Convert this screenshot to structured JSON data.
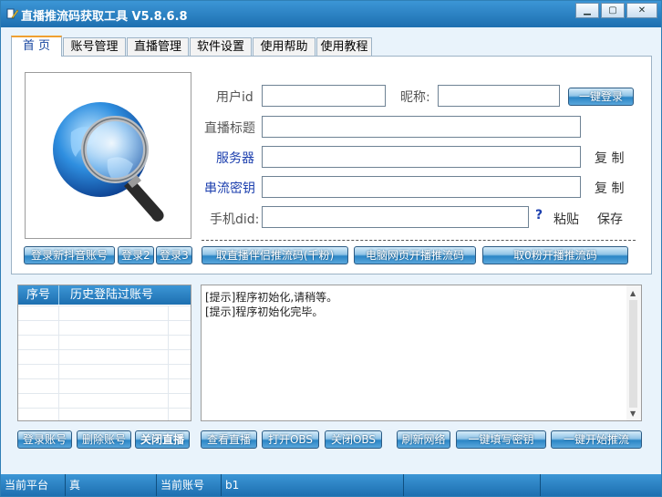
{
  "window": {
    "title": "直播推流码获取工具 V5.8.6.8",
    "controls": [
      "minimize",
      "maximize",
      "close"
    ]
  },
  "tabs": [
    {
      "label": "首 页",
      "active": true
    },
    {
      "label": "账号管理",
      "active": false
    },
    {
      "label": "直播管理",
      "active": false
    },
    {
      "label": "软件设置",
      "active": false
    },
    {
      "label": "使用帮助",
      "active": false
    },
    {
      "label": "使用教程",
      "active": false
    }
  ],
  "form": {
    "user_id_label": "用户id",
    "user_id_value": "",
    "nickname_label": "昵称:",
    "nickname_value": "",
    "one_click_login": "一键登录",
    "live_title_label": "直播标题",
    "live_title_value": "",
    "server_label": "服务器",
    "server_value": "",
    "copy1": "复 制",
    "stream_key_label": "串流密钥",
    "stream_key_value": "",
    "copy2": "复 制",
    "phone_did_label": "手机did:",
    "phone_did_value": "",
    "help_icon": "?",
    "paste": "粘贴",
    "save": "保存"
  },
  "logo_icon": "magnifier-globe-icon",
  "left_buttons": {
    "login_new": "登录新抖音账号",
    "login2": "登录2",
    "login3": "登录3"
  },
  "action_buttons": {
    "get_companion": "取直播伴侣推流码(千粉)",
    "pc_web": "电脑网页开播推流码",
    "zero_fans": "取0粉开播推流码"
  },
  "history": {
    "col_index": "序号",
    "col_account": "历史登陆过账号",
    "rows": []
  },
  "log": {
    "lines": [
      "[提示]程序初始化,请稍等。",
      "[提示]程序初始化完毕。"
    ]
  },
  "bottom_buttons": {
    "login_account": "登录账号",
    "delete_account": "删除账号",
    "close_live": "关闭直播",
    "view_live": "查看直播",
    "open_obs": "打开OBS",
    "close_obs": "关闭OBS",
    "refresh_network": "刷新网络",
    "fill_key": "一键填写密钥",
    "start_push": "一键开始推流"
  },
  "status": {
    "platform_label": "当前平台",
    "platform_value": "真",
    "account_label": "当前账号",
    "account_value": "b1"
  },
  "colors": {
    "titlebar": "#2b86c6",
    "accent_label": "#1c3fae",
    "tab_highlight": "#f0a030"
  }
}
